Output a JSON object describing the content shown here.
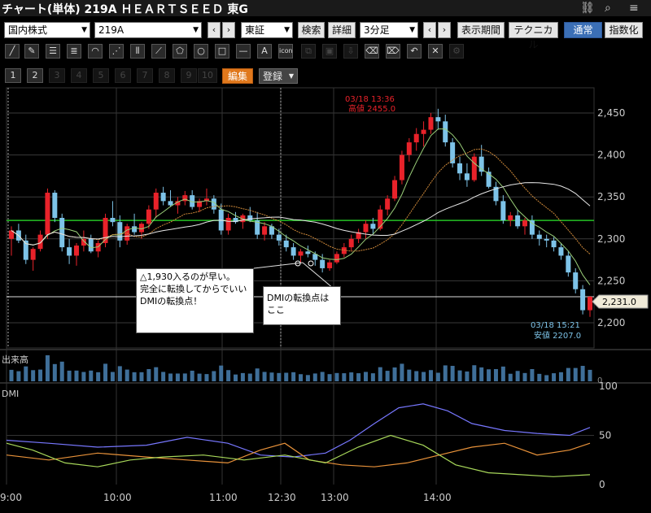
{
  "title": "チャート(単体) 219A ＨＥＡＲＴＳＥＥＤ 東G",
  "icons": {
    "link": "link-icon",
    "search": "search-icon",
    "menu": "menu-icon"
  },
  "controls": {
    "market": "国内株式",
    "code": "219A",
    "exchange": "東証",
    "search": "検索",
    "detail": "詳細",
    "interval": "3分足",
    "period": "表示期間",
    "technical": "テクニカル",
    "normal": "通常",
    "index": "指数化"
  },
  "tools": [
    "line",
    "pencil",
    "hlines",
    "hlines2",
    "arc",
    "fan",
    "vlines",
    "ray",
    "pentagon",
    "circle",
    "rect",
    "hline",
    "A",
    "icon"
  ],
  "pages": [
    "1",
    "2",
    "3",
    "4",
    "5",
    "6",
    "7",
    "8",
    "9",
    "10"
  ],
  "page_actions": {
    "edit": "編集",
    "register": "登録"
  },
  "annotations": {
    "high": {
      "label": "03/18 13:36",
      "value": "高値 2455.0"
    },
    "low": {
      "label": "03/18 15:21",
      "value": "安値 2207.0"
    },
    "current": "2,231.0",
    "note1": [
      "△1,930入るのが早い。",
      "完全に転換してからでいい",
      "DMIの転換点！"
    ],
    "note2": [
      "DMIの転換点は",
      "ここ"
    ]
  },
  "chart_data": {
    "type": "candlestick",
    "price_axis": {
      "ticks": [
        "2,450",
        "2,400",
        "2,350",
        "2,300",
        "2,250",
        "2,200"
      ],
      "range": [
        2170,
        2480
      ]
    },
    "time_axis": {
      "ticks": [
        "9:00",
        "10:00",
        "11:00",
        "12:30",
        "13:00",
        "14:00"
      ]
    },
    "volume_label": "出来高",
    "dmi_label": "DMI",
    "dmi_axis": {
      "ticks": [
        "100",
        "50",
        "0"
      ]
    },
    "green_level": 2322,
    "white_level": 2231,
    "colors": {
      "up": "#e8222a",
      "down": "#7dc3e8",
      "green": "#25c225",
      "pdi": "#7777ff",
      "mdi": "#e8923a",
      "adx": "#a8d85a"
    },
    "candles": [
      [
        2300,
        2315,
        2280,
        2310
      ],
      [
        2310,
        2318,
        2295,
        2298
      ],
      [
        2298,
        2305,
        2270,
        2275
      ],
      [
        2275,
        2290,
        2262,
        2288
      ],
      [
        2288,
        2310,
        2285,
        2305
      ],
      [
        2305,
        2360,
        2300,
        2355
      ],
      [
        2355,
        2358,
        2320,
        2325
      ],
      [
        2325,
        2330,
        2285,
        2290
      ],
      [
        2290,
        2300,
        2270,
        2280
      ],
      [
        2280,
        2295,
        2268,
        2292
      ],
      [
        2292,
        2310,
        2285,
        2300
      ],
      [
        2300,
        2305,
        2283,
        2285
      ],
      [
        2285,
        2298,
        2278,
        2295
      ],
      [
        2295,
        2330,
        2290,
        2325
      ],
      [
        2325,
        2345,
        2315,
        2320
      ],
      [
        2320,
        2328,
        2290,
        2298
      ],
      [
        2298,
        2318,
        2293,
        2315
      ],
      [
        2315,
        2330,
        2305,
        2308
      ],
      [
        2308,
        2320,
        2300,
        2318
      ],
      [
        2318,
        2340,
        2312,
        2335
      ],
      [
        2335,
        2360,
        2325,
        2355
      ],
      [
        2355,
        2362,
        2340,
        2345
      ],
      [
        2345,
        2358,
        2338,
        2340
      ],
      [
        2340,
        2350,
        2330,
        2345
      ],
      [
        2345,
        2357,
        2340,
        2352
      ],
      [
        2352,
        2358,
        2335,
        2338
      ],
      [
        2338,
        2348,
        2332,
        2345
      ],
      [
        2345,
        2360,
        2340,
        2348
      ],
      [
        2348,
        2352,
        2330,
        2335
      ],
      [
        2335,
        2342,
        2305,
        2310
      ],
      [
        2310,
        2330,
        2305,
        2325
      ],
      [
        2325,
        2332,
        2318,
        2320
      ],
      [
        2320,
        2330,
        2312,
        2328
      ],
      [
        2328,
        2338,
        2320,
        2322
      ],
      [
        2322,
        2332,
        2300,
        2305
      ],
      [
        2305,
        2320,
        2298,
        2315
      ],
      [
        2315,
        2318,
        2300,
        2305
      ],
      [
        2305,
        2312,
        2292,
        2298
      ],
      [
        2298,
        2305,
        2285,
        2290
      ],
      [
        2290,
        2295,
        2275,
        2280
      ],
      [
        2280,
        2288,
        2272,
        2285
      ],
      [
        2285,
        2292,
        2278,
        2282
      ],
      [
        2282,
        2285,
        2268,
        2275
      ],
      [
        2275,
        2282,
        2260,
        2265
      ],
      [
        2265,
        2275,
        2262,
        2272
      ],
      [
        2272,
        2285,
        2270,
        2282
      ],
      [
        2282,
        2295,
        2278,
        2290
      ],
      [
        2290,
        2305,
        2286,
        2300
      ],
      [
        2300,
        2312,
        2295,
        2308
      ],
      [
        2308,
        2322,
        2300,
        2318
      ],
      [
        2318,
        2325,
        2305,
        2312
      ],
      [
        2312,
        2340,
        2310,
        2335
      ],
      [
        2335,
        2352,
        2328,
        2348
      ],
      [
        2348,
        2375,
        2345,
        2370
      ],
      [
        2370,
        2405,
        2365,
        2400
      ],
      [
        2400,
        2420,
        2392,
        2415
      ],
      [
        2415,
        2432,
        2405,
        2425
      ],
      [
        2425,
        2440,
        2410,
        2430
      ],
      [
        2430,
        2450,
        2425,
        2445
      ],
      [
        2445,
        2455,
        2430,
        2440
      ],
      [
        2440,
        2448,
        2410,
        2415
      ],
      [
        2415,
        2420,
        2385,
        2390
      ],
      [
        2390,
        2398,
        2370,
        2378
      ],
      [
        2378,
        2390,
        2362,
        2370
      ],
      [
        2370,
        2402,
        2368,
        2398
      ],
      [
        2398,
        2412,
        2375,
        2380
      ],
      [
        2380,
        2385,
        2360,
        2362
      ],
      [
        2362,
        2368,
        2340,
        2345
      ],
      [
        2345,
        2352,
        2318,
        2322
      ],
      [
        2322,
        2332,
        2315,
        2328
      ],
      [
        2328,
        2335,
        2312,
        2315
      ],
      [
        2315,
        2325,
        2305,
        2322
      ],
      [
        2322,
        2328,
        2300,
        2305
      ],
      [
        2305,
        2310,
        2292,
        2300
      ],
      [
        2300,
        2305,
        2290,
        2298
      ],
      [
        2298,
        2302,
        2285,
        2290
      ],
      [
        2290,
        2295,
        2275,
        2280
      ],
      [
        2280,
        2285,
        2255,
        2260
      ],
      [
        2260,
        2265,
        2235,
        2240
      ],
      [
        2240,
        2245,
        2210,
        2215
      ],
      [
        2215,
        2232,
        2207,
        2231
      ]
    ]
  }
}
